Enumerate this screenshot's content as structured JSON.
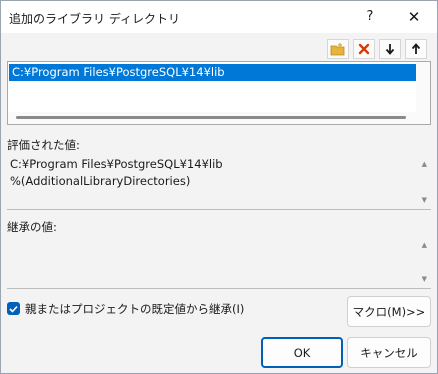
{
  "dialog": {
    "title": "追加のライブラリ ディレクトリ",
    "help_glyph": "?",
    "close_glyph": "✕"
  },
  "toolbar": {
    "icons": [
      "new-folder-icon",
      "delete-icon",
      "move-down-icon",
      "move-up-icon"
    ]
  },
  "list": {
    "items": [
      "C:¥Program Files¥PostgreSQL¥14¥lib"
    ]
  },
  "evaluated": {
    "label": "評価された値:",
    "lines": [
      "C:¥Program Files¥PostgreSQL¥14¥lib",
      "%(AdditionalLibraryDirectories)"
    ]
  },
  "inherited": {
    "label": "継承の値:",
    "lines": []
  },
  "inherit_checkbox": {
    "label": "親またはプロジェクトの既定値から継承(I)",
    "checked": true
  },
  "buttons": {
    "macro": "マクロ(M)>>",
    "ok": "OK",
    "cancel": "キャンセル"
  },
  "colors": {
    "accent": "#005fb8",
    "selection": "#0078d7",
    "delete_red": "#d83b01",
    "folder_yellow": "#e8b33a"
  }
}
